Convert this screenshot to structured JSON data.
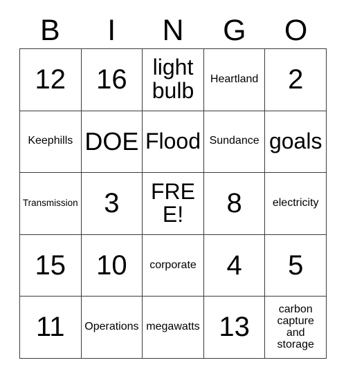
{
  "card": {
    "type": "bingo-card",
    "header_letters": [
      "B",
      "I",
      "N",
      "G",
      "O"
    ],
    "columns": 5,
    "rows": 5,
    "free_space_label": "FREE!",
    "free_space_position": {
      "row": 3,
      "column": 3
    },
    "colors": {
      "background": "#ffffff",
      "text": "#000000",
      "grid_line": "#3a3a3a"
    },
    "cells": [
      [
        {
          "text": "12",
          "size": "xl"
        },
        {
          "text": "16",
          "size": "xl"
        },
        {
          "text": "light bulb",
          "size": "md"
        },
        {
          "text": "Heartland",
          "size": "xs"
        },
        {
          "text": "2",
          "size": "xl"
        }
      ],
      [
        {
          "text": "Keephills",
          "size": "xs"
        },
        {
          "text": "DOE",
          "size": "lg"
        },
        {
          "text": "Flood",
          "size": "md"
        },
        {
          "text": "Sundance",
          "size": "xs"
        },
        {
          "text": "goals",
          "size": "md"
        }
      ],
      [
        {
          "text": "Transmission",
          "size": "xxs"
        },
        {
          "text": "3",
          "size": "xl"
        },
        {
          "text": "FREE!",
          "size": "md"
        },
        {
          "text": "8",
          "size": "xl"
        },
        {
          "text": "electricity",
          "size": "xs"
        }
      ],
      [
        {
          "text": "15",
          "size": "xl"
        },
        {
          "text": "10",
          "size": "xl"
        },
        {
          "text": "corporate",
          "size": "xs"
        },
        {
          "text": "4",
          "size": "xl"
        },
        {
          "text": "5",
          "size": "xl"
        }
      ],
      [
        {
          "text": "11",
          "size": "xl"
        },
        {
          "text": "Operations",
          "size": "xs"
        },
        {
          "text": "megawatts",
          "size": "xs"
        },
        {
          "text": "13",
          "size": "xl"
        },
        {
          "text": "carbon capture and storage",
          "size": "xs"
        }
      ]
    ]
  }
}
